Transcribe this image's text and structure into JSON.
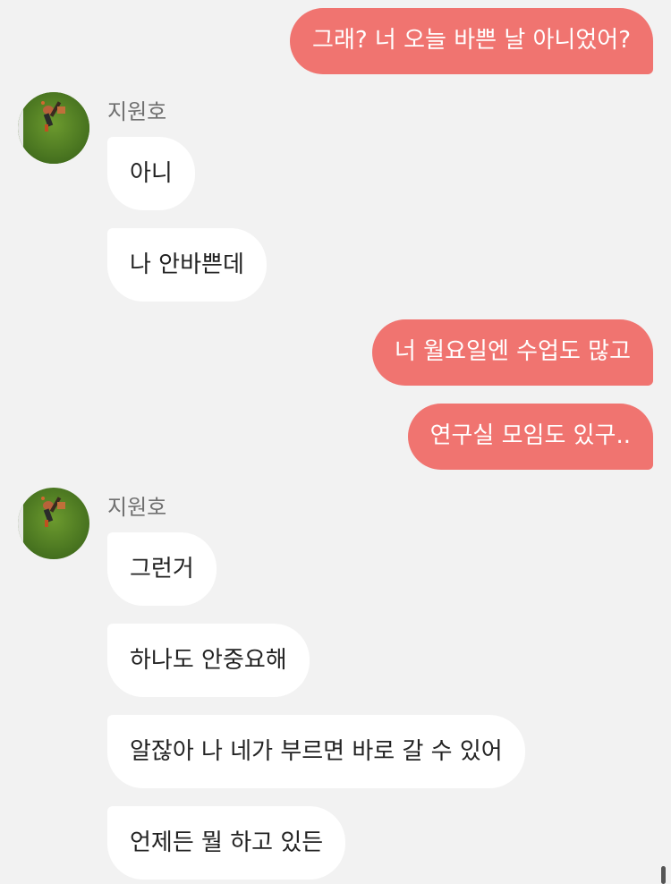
{
  "colors": {
    "background": "#f2f2f2",
    "outgoing_bubble": "#f07470",
    "incoming_bubble": "#ffffff",
    "sender_name": "#707070"
  },
  "messages": {
    "m1": "그래? 너 오늘 바쁜 날 아니었어?",
    "m2": "아니",
    "m3": "나 안바쁜데",
    "m4": "너 월요일엔 수업도 많고",
    "m5": "연구실 모임도 있구..",
    "m6": "그런거",
    "m7": "하나도 안중요해",
    "m8": "알잖아 나 네가 부르면 바로 갈 수 있어",
    "m9": "언제든 뭘 하고 있든"
  },
  "group1": {
    "sender": "지원호",
    "avatar_icon": "profile-photo-icon"
  },
  "group2": {
    "sender": "지원호",
    "avatar_icon": "profile-photo-icon"
  }
}
